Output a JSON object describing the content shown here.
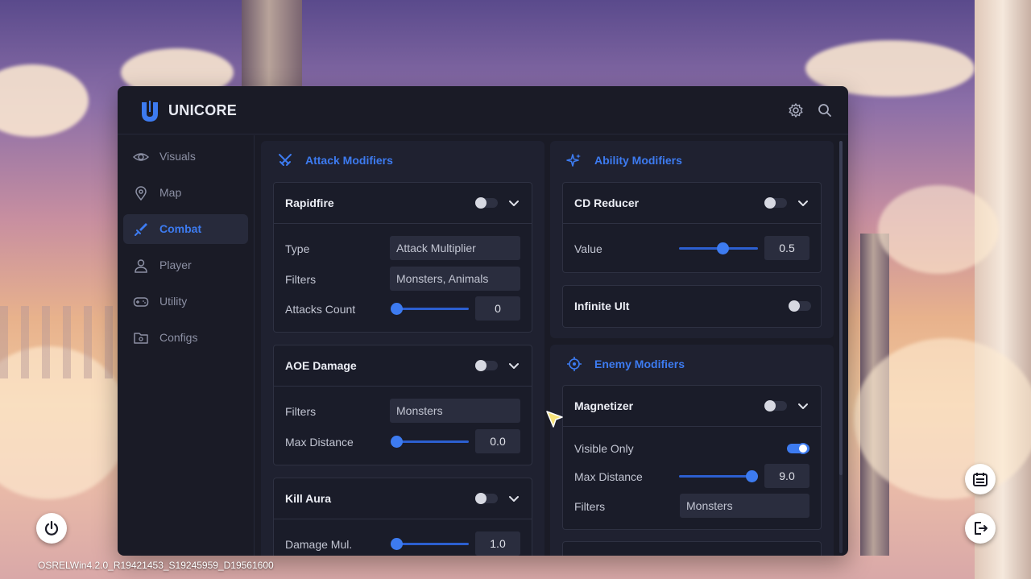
{
  "app": {
    "brand": "UNICORE",
    "version": "OSRELWin4.2.0_R19421453_S19245959_D19561600"
  },
  "sidebar": {
    "items": [
      {
        "label": "Visuals",
        "icon": "eye-icon",
        "active": false
      },
      {
        "label": "Map",
        "icon": "map-pin-icon",
        "active": false
      },
      {
        "label": "Combat",
        "icon": "sword-icon",
        "active": true
      },
      {
        "label": "Player",
        "icon": "user-icon",
        "active": false
      },
      {
        "label": "Utility",
        "icon": "gamepad-icon",
        "active": false
      },
      {
        "label": "Configs",
        "icon": "folder-gear-icon",
        "active": false
      }
    ]
  },
  "attack": {
    "title": "Attack Modifiers",
    "rapidfire": {
      "title": "Rapidfire",
      "enabled": false,
      "type_label": "Type",
      "type_value": "Attack Multiplier",
      "filters_label": "Filters",
      "filters_value": "Monsters, Animals",
      "count_label": "Attacks Count",
      "count_value": "0",
      "count_fraction": 0.0
    },
    "aoe": {
      "title": "AOE Damage",
      "enabled": false,
      "filters_label": "Filters",
      "filters_value": "Monsters",
      "distance_label": "Max Distance",
      "distance_value": "0.0",
      "distance_fraction": 0.0
    },
    "killaura": {
      "title": "Kill Aura",
      "enabled": false,
      "damage_label": "Damage Mul.",
      "damage_value": "1.0",
      "damage_fraction": 0.0
    }
  },
  "ability": {
    "title": "Ability Modifiers",
    "cd_reducer": {
      "title": "CD Reducer",
      "enabled": false,
      "value_label": "Value",
      "value": "0.5",
      "value_fraction": 0.55
    },
    "infinite_ult": {
      "title": "Infinite Ult",
      "enabled": false
    }
  },
  "enemy": {
    "title": "Enemy Modifiers",
    "magnetizer": {
      "title": "Magnetizer",
      "enabled": false,
      "visible_only_label": "Visible Only",
      "visible_only": true,
      "distance_label": "Max Distance",
      "distance_value": "9.0",
      "distance_fraction": 0.92,
      "filters_label": "Filters",
      "filters_value": "Monsters"
    }
  },
  "colors": {
    "accent": "#3d7bf0",
    "panel": "#1a1b26",
    "card": "#1a1c29"
  }
}
